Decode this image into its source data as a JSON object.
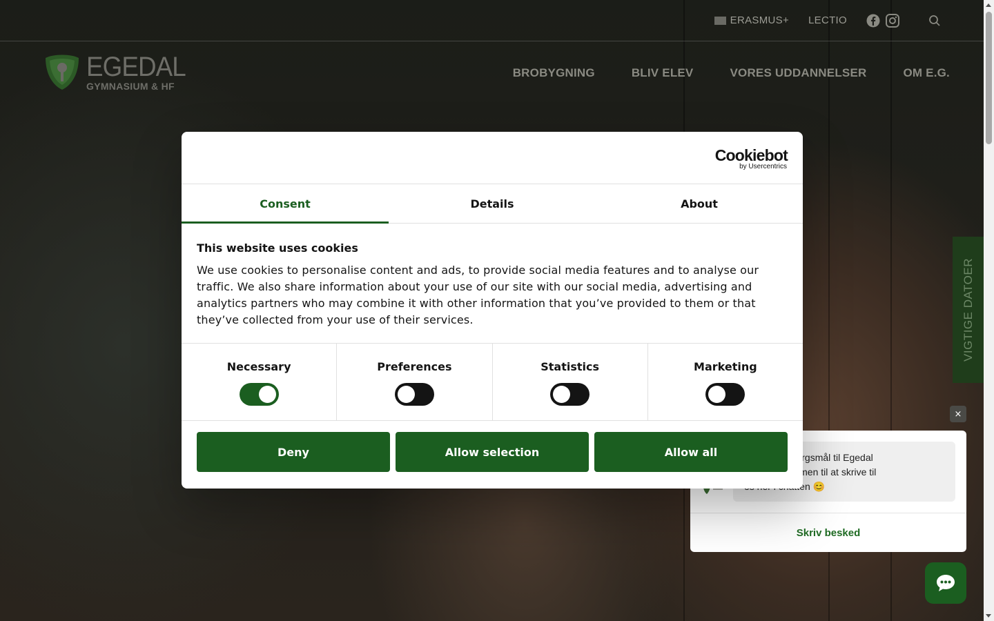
{
  "topbar": {
    "erasmus_label": "ERASMUS+",
    "lectio_label": "LECTIO",
    "icons": [
      "facebook-icon",
      "instagram-icon",
      "search-icon"
    ]
  },
  "logo": {
    "name": "EGEDAL",
    "subtitle": "GYMNASIUM & HF"
  },
  "nav": {
    "items": [
      "BROBYGNING",
      "BLIV ELEV",
      "VORES UDDANNELSER",
      "OM E.G."
    ]
  },
  "side_tab": {
    "label": "VIGTIGE DATOER"
  },
  "cookie_dialog": {
    "brand": "Cookiebot",
    "brand_sub": "by Usercentrics",
    "tabs": [
      "Consent",
      "Details",
      "About"
    ],
    "active_tab": "Consent",
    "title": "This website uses cookies",
    "body": "We use cookies to personalise content and ads, to provide social media features and to analyse our traffic. We also share information about your use of our site with our social media, advertising and analytics partners who may combine it with other information that you’ve provided to them or that they’ve collected from your use of their services.",
    "toggles": [
      {
        "label": "Necessary",
        "on": true
      },
      {
        "label": "Preferences",
        "on": false
      },
      {
        "label": "Statistics",
        "on": false
      },
      {
        "label": "Marketing",
        "on": false
      }
    ],
    "buttons": {
      "deny": "Deny",
      "allow_selection": "Allow selection",
      "allow_all": "Allow all"
    }
  },
  "chat": {
    "close_label": "×",
    "message_line1": "il! Har du spørgsmål til Egedal",
    "message_line2": "er du velkommen til at skrive til",
    "message_line3": "os her i chatten 😊",
    "reply_label": "Skriv besked"
  },
  "colors": {
    "brand_green": "#1b5e20",
    "text_dark": "#141414"
  }
}
